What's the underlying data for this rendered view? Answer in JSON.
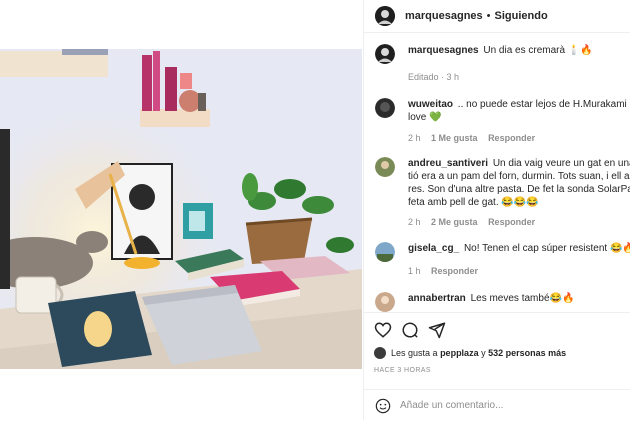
{
  "post": {
    "username": "marquesagnes",
    "separator": "•",
    "follow_status": "Siguiendo"
  },
  "caption": {
    "username": "marquesagnes",
    "text": "Un dia es cremarà 🕯️🔥",
    "edited": "Editado",
    "age": "3 h"
  },
  "comments": [
    {
      "username": "wuweitao",
      "lines": [
        ".. no puede estar lejos de H.Murakami 🔥",
        "love 💚"
      ],
      "age": "2 h",
      "likes": "1 Me gusta",
      "reply": "Responder"
    },
    {
      "username": "andreu_santiveri",
      "lines": [
        "Un dia vaig veure un gat en una fra",
        "tió era a un pam del forn, durmin. Tots suan, i ell allà",
        "res. Son d'una altre pasta. De fet la sonda SolarParke",
        "feta amb pell de gat. 😂😂😂"
      ],
      "age": "2 h",
      "likes": "2 Me gusta",
      "reply": "Responder"
    },
    {
      "username": "gisela_cg_",
      "lines": [
        "No! Tenen el cap súper resistent 😂🔥"
      ],
      "age": "1 h",
      "likes": "",
      "reply": "Responder"
    },
    {
      "username": "annabertran",
      "lines": [
        "Les meves també😂🔥"
      ]
    }
  ],
  "likes": {
    "prefix": "Les gusta a",
    "first_user": "pepplaza",
    "connector": "y",
    "others": "532 personas más"
  },
  "timestamp": "HACE 3 HORAS",
  "add_comment": {
    "placeholder": "Añade un comentario..."
  },
  "icons": {
    "like": "heart-icon",
    "comment": "speech-bubble-icon",
    "share": "paper-plane-icon",
    "emoji": "smiley-icon"
  }
}
